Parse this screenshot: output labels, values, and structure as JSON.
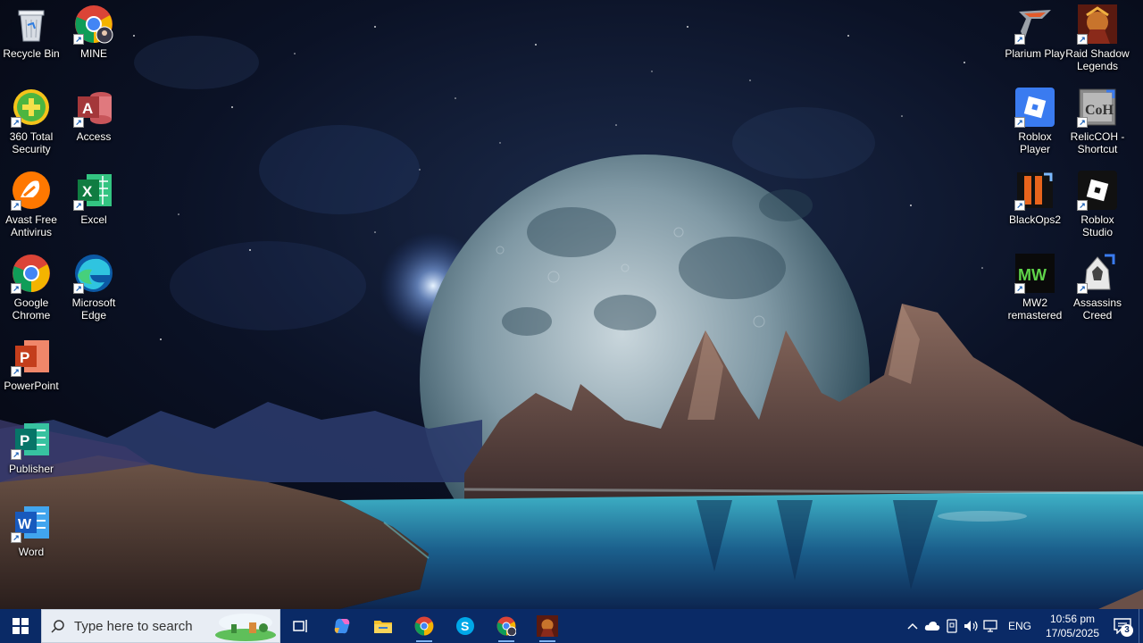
{
  "desktop": {
    "left_column_1": [
      {
        "label": "Recycle Bin",
        "icon": "recycle-bin-icon"
      },
      {
        "label": "360 Total Security",
        "icon": "security-360-icon"
      },
      {
        "label": "Avast Free Antivirus",
        "icon": "avast-icon"
      },
      {
        "label": "Google Chrome",
        "icon": "chrome-icon"
      },
      {
        "label": "PowerPoint",
        "icon": "powerpoint-icon"
      },
      {
        "label": "Publisher",
        "icon": "publisher-icon"
      },
      {
        "label": "Word",
        "icon": "word-icon"
      }
    ],
    "left_column_2": [
      {
        "label": "MINE",
        "icon": "chrome-profile-icon"
      },
      {
        "label": "Access",
        "icon": "access-icon"
      },
      {
        "label": "Excel",
        "icon": "excel-icon"
      },
      {
        "label": "Microsoft Edge",
        "icon": "edge-icon"
      }
    ],
    "right_column_1": [
      {
        "label": "Plarium Play",
        "icon": "plarium-icon"
      },
      {
        "label": "Roblox Player",
        "icon": "roblox-icon"
      },
      {
        "label": "BlackOps2",
        "icon": "blackops-icon"
      },
      {
        "label": "MW2 remastered",
        "icon": "mw2-icon"
      }
    ],
    "right_column_2": [
      {
        "label": "Raid Shadow Legends",
        "icon": "raid-icon"
      },
      {
        "label": "RelicCOH - Shortcut",
        "icon": "relic-coh-icon"
      },
      {
        "label": "Roblox Studio",
        "icon": "roblox-studio-icon"
      },
      {
        "label": "Assassins Creed",
        "icon": "assassins-creed-icon"
      }
    ]
  },
  "taskbar": {
    "search_placeholder": "Type here to search",
    "apps": [
      "task-view-icon",
      "copilot-icon",
      "file-explorer-icon",
      "chrome-icon",
      "skype-icon",
      "chrome-profile-icon",
      "raid-icon"
    ],
    "tray": {
      "language": "ENG",
      "time": "10:56 pm",
      "date": "17/05/2025",
      "notification_count": "3"
    }
  },
  "colors": {
    "taskbar": "#0a2a66",
    "search_box": "#e8edf4"
  }
}
